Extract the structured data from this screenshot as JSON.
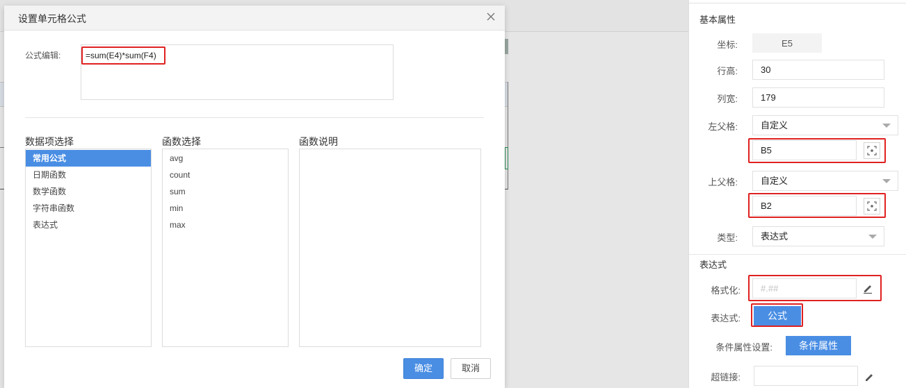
{
  "dialog": {
    "title": "设置单元格公式",
    "formula_label": "公式编辑:",
    "formula_value": "=sum(E4)*sum(F4)",
    "data_items": {
      "title": "数据项选择",
      "items": [
        "常用公式",
        "日期函数",
        "数学函数",
        "字符串函数",
        "表达式"
      ]
    },
    "functions": {
      "title": "函数选择",
      "items": [
        "avg",
        "count",
        "sum",
        "min",
        "max"
      ]
    },
    "description": {
      "title": "函数说明"
    },
    "ok_label": "确定",
    "cancel_label": "取消"
  },
  "panel": {
    "basic_title": "基本属性",
    "coord_label": "坐标:",
    "coord_value": "E5",
    "row_height_label": "行高:",
    "row_height_value": "30",
    "col_width_label": "列宽:",
    "col_width_value": "179",
    "left_parent_label": "左父格:",
    "left_parent_select": "自定义",
    "left_parent_value": "B5",
    "top_parent_label": "上父格:",
    "top_parent_select": "自定义",
    "top_parent_value": "B2",
    "type_label": "类型:",
    "type_select": "表达式",
    "expr_title": "表达式",
    "format_label": "格式化:",
    "format_placeholder": "#.##",
    "expr_label": "表达式:",
    "formula_button": "公式",
    "condition_label": "条件属性设置:",
    "condition_button": "条件属性",
    "hyperlink_label": "超链接:"
  },
  "colors": {
    "accent": "#4a8ee4",
    "highlight": "#e02020"
  }
}
